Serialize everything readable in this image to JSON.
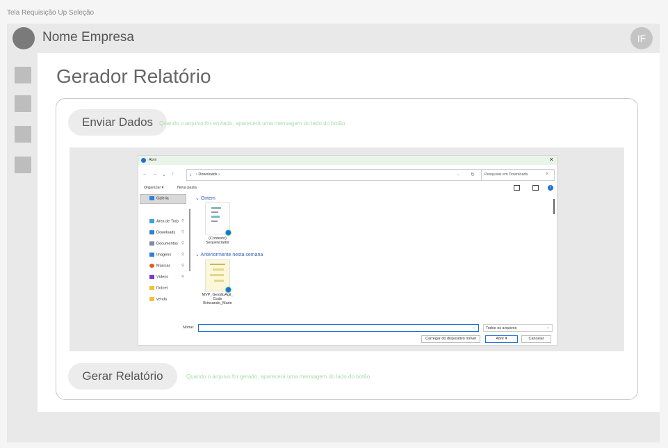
{
  "caption": "Tela Requisição Up Seleção",
  "header": {
    "company": "Nome Empresa",
    "user_initials": "IF"
  },
  "sidebar": {
    "items": [
      "nav-1",
      "nav-2",
      "nav-3",
      "nav-4"
    ]
  },
  "main": {
    "title": "Gerador Relatório",
    "send_button": "Enviar Dados",
    "send_hint": "Quando o arquivo for enviado, aparecerá uma mensagem do lado do botão",
    "report_button": "Gerar Relatório",
    "report_hint": "Quando o arquivo for gerado, aparecerá uma mensagem do lado do botão"
  },
  "dialog": {
    "title": "Abrir",
    "close": "✕",
    "nav": {
      "back": "←",
      "forward": "→",
      "history": "⌄",
      "up": "↑"
    },
    "address": "› Downloads ›",
    "search_placeholder": "Pesquisar em Downloads",
    "organize": "Organizar ▾",
    "new_folder": "Nova pasta",
    "tree": [
      {
        "label": "Galeria",
        "color": "#2f7fd8"
      },
      {
        "label": "Área de Trab",
        "color": "#3aa0e0"
      },
      {
        "label": "Downloads",
        "color": "#2f7fd8"
      },
      {
        "label": "Documentos",
        "color": "#7f8aa0"
      },
      {
        "label": "Imagens",
        "color": "#2f7fd8"
      },
      {
        "label": "Músicas",
        "color": "#e05a2a"
      },
      {
        "label": "Vídeos",
        "color": "#7a3ad0"
      },
      {
        "label": "Dotnet",
        "color": "#f3c13a"
      },
      {
        "label": "venda",
        "color": "#f3c13a"
      }
    ],
    "groups": [
      {
        "label": "Ontem",
        "file": "(Contexto) Sequenciador"
      },
      {
        "label": "Anteriormente nesta semana",
        "file": "MVP_GestãoÁgil_ Code Brincando_Marin"
      }
    ],
    "name_label": "Nome:",
    "file_type": "Todos os arquivos",
    "upload": "Carregar do dispositivo móvel",
    "open": "Abrir",
    "cancel": "Cancelar"
  }
}
